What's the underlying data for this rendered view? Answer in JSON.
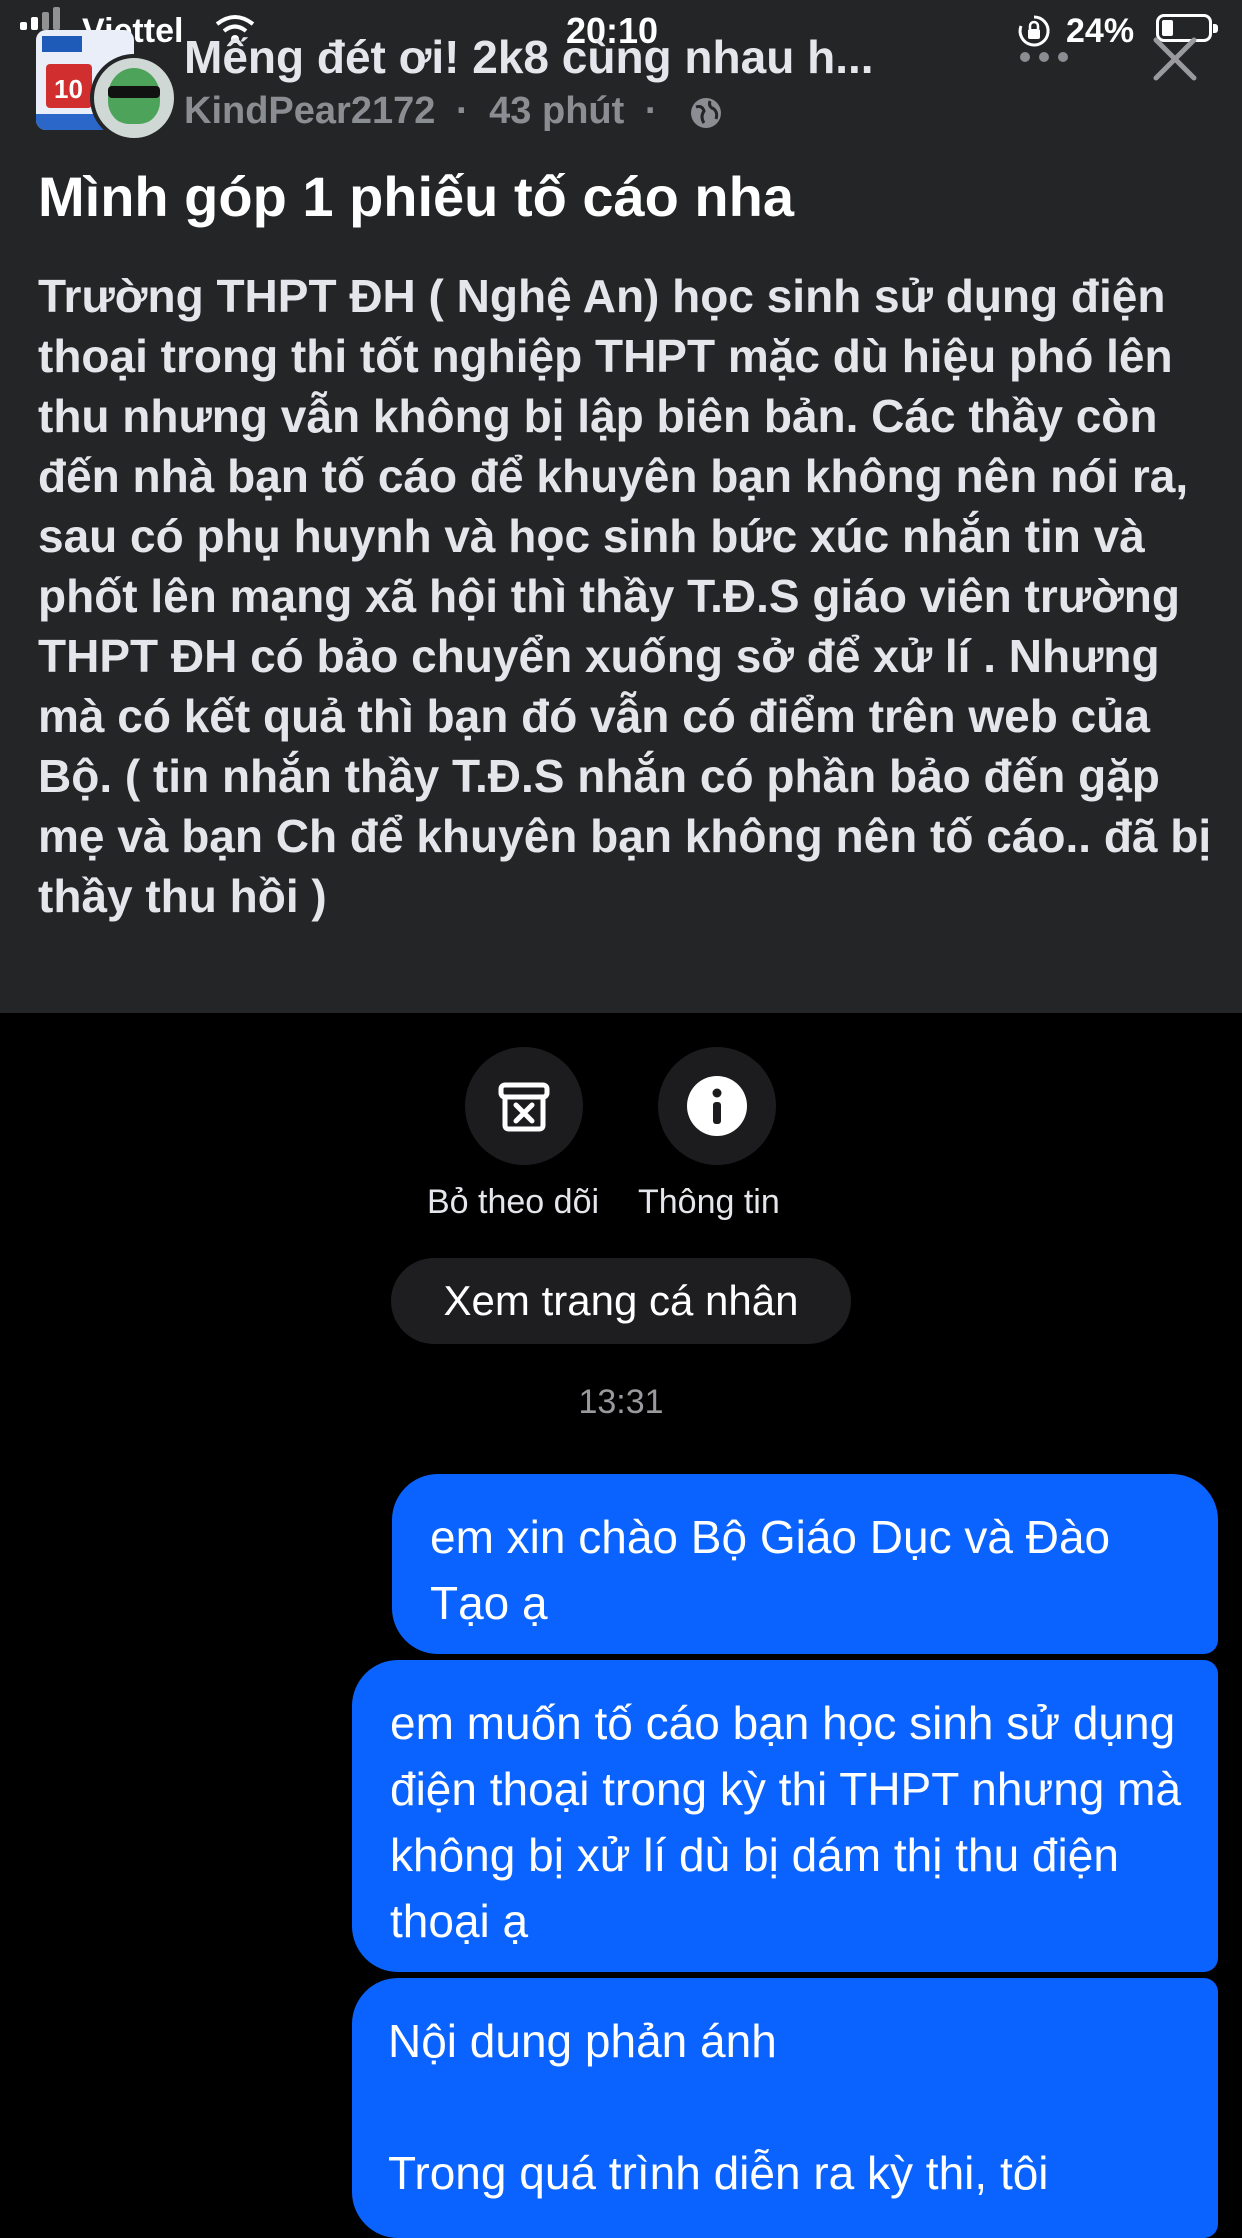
{
  "status_bar": {
    "carrier": "Viettel",
    "time": "20:10",
    "battery": "24%"
  },
  "post": {
    "group_name": "Mếng đét ơi! 2k8 cùng nhau h...",
    "author": "KindPear2172",
    "age": "43 phút",
    "separator": "·",
    "title": "Mình góp 1 phiếu tố cáo nha",
    "body": "Trường THPT ĐH ( Nghệ An) học sinh sử dụng điện thoại trong thi tốt nghiệp THPT mặc dù hiệu phó lên thu nhưng vẫn không bị lập biên bản. Các thầy còn đến nhà bạn tố cáo để khuyên bạn không nên nói ra, sau có phụ huynh và học sinh bức xúc nhắn tin và phốt lên mạng xã hội thì thầy T.Đ.S giáo viên trường THPT ĐH có bảo chuyển xuống sở để xử lí . Nhưng mà có kết quả thì bạn đó vẫn có điểm trên web của Bộ. ( tin nhắn thầy T.Đ.S nhắn có phần bảo đến gặp mẹ và bạn Ch để khuyên bạn không nên tố cáo.. đã bị thầy thu hồi )"
  },
  "chat": {
    "unfollow_label": "Bỏ theo dõi",
    "info_label": "Thông tin",
    "profile_button": "Xem trang cá nhân",
    "timestamp": "13:31",
    "messages": [
      "em xin chào Bộ Giáo Dục và Đào Tạo ạ",
      "em muốn tố cáo bạn học sinh sử dụng điện thoại trong kỳ thi THPT nhưng mà không bị xử lí dù bị dám thị thu điện thoại ạ"
    ],
    "message3_line1": "Nội dung phản ánh",
    "message3_line2": "Trong quá trình diễn ra kỳ thi, tôi"
  },
  "colors": {
    "panel_bg": "#242526",
    "bubble_blue": "#0a63ff",
    "muted_text": "#8a8d91"
  },
  "icons": [
    "signal-icon",
    "wifi-icon",
    "rotation-lock-icon",
    "battery-icon",
    "globe-icon",
    "more-icon",
    "close-icon",
    "archive-x-icon",
    "info-icon"
  ]
}
